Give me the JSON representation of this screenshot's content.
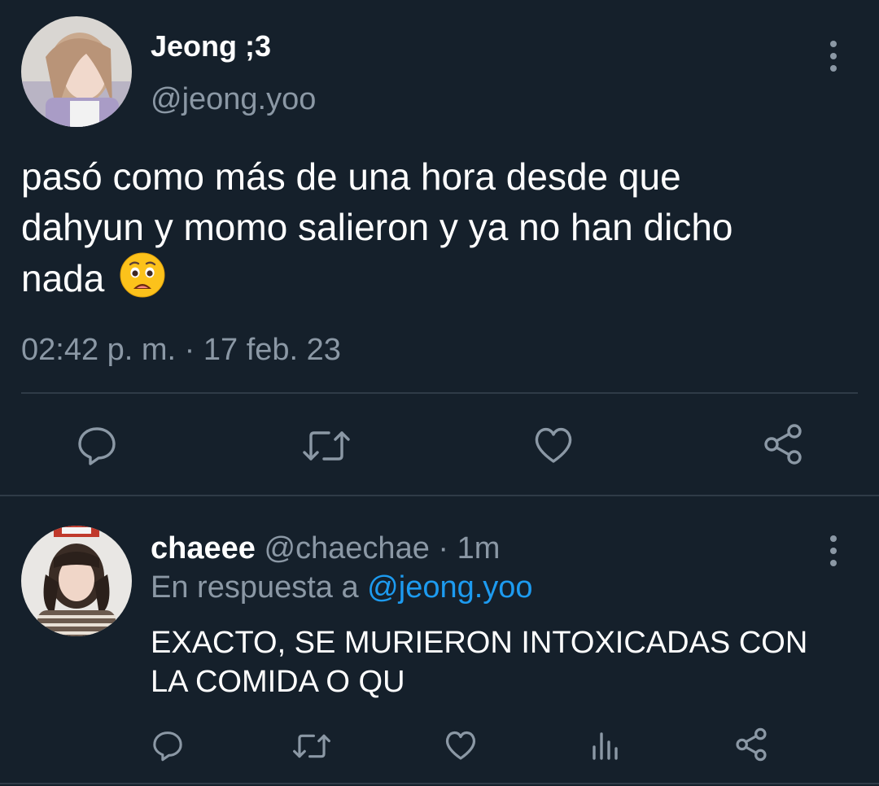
{
  "tweet": {
    "display_name": "Jeong ;3",
    "handle": "@jeong.yoo",
    "text_line1": "pasó como más de una hora desde que",
    "text_line2": "dahyun y momo salieron y ya no han dicho",
    "text_line3": "nada",
    "emoji": "😧",
    "timestamp": "02:42 p. m. · 17 feb. 23",
    "actions": [
      "reply-icon",
      "retweet-icon",
      "like-icon",
      "share-icon"
    ]
  },
  "reply": {
    "display_name": "chaeee",
    "handle": "@chaechae",
    "separator": "·",
    "time": "1m",
    "in_reply_prefix": "En respuesta a",
    "in_reply_handle": "@jeong.yoo",
    "text_line1": "EXACTO, SE MURIERON INTOXICADAS CON",
    "text_line2": "LA COMIDA O QU",
    "actions": [
      "reply-icon",
      "retweet-icon",
      "like-icon",
      "analytics-icon",
      "share-icon"
    ]
  },
  "colors": {
    "background": "#15202b",
    "muted": "#8b98a5",
    "link": "#1d9bf0",
    "text": "#ffffff"
  }
}
